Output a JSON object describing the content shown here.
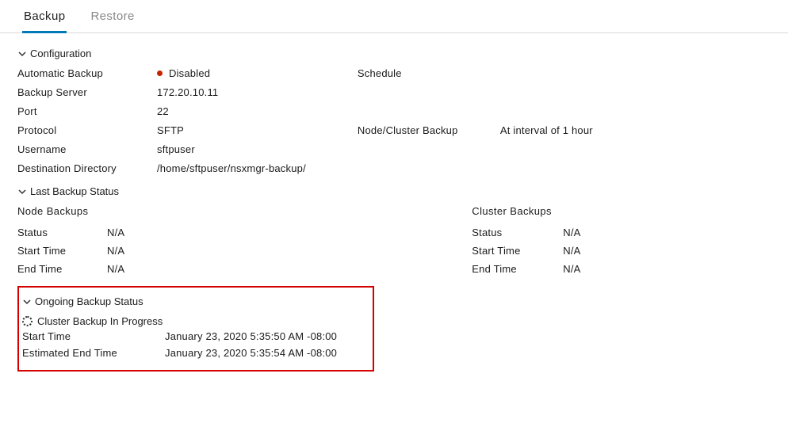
{
  "tabs": {
    "backup": "Backup",
    "restore": "Restore"
  },
  "sections": {
    "configuration": "Configuration",
    "last_backup_status": "Last Backup Status",
    "ongoing_backup_status": "Ongoing Backup Status"
  },
  "config": {
    "automatic_backup_label": "Automatic Backup",
    "automatic_backup_value": "Disabled",
    "backup_server_label": "Backup Server",
    "backup_server_value": "172.20.10.11",
    "port_label": "Port",
    "port_value": "22",
    "protocol_label": "Protocol",
    "protocol_value": "SFTP",
    "username_label": "Username",
    "username_value": "sftpuser",
    "dest_dir_label": "Destination Directory",
    "dest_dir_value": "/home/sftpuser/nsxmgr-backup/",
    "schedule_label": "Schedule",
    "node_cluster_label": "Node/Cluster Backup",
    "node_cluster_value": "At interval of 1 hour"
  },
  "last": {
    "node_heading": "Node Backups",
    "cluster_heading": "Cluster Backups",
    "status_label": "Status",
    "start_time_label": "Start Time",
    "end_time_label": "End Time",
    "node_status": "N/A",
    "node_start": "N/A",
    "node_end": "N/A",
    "cluster_status": "N/A",
    "cluster_start": "N/A",
    "cluster_end": "N/A"
  },
  "ongoing": {
    "progress_text": "Cluster Backup In Progress",
    "start_time_label": "Start Time",
    "start_time_value": "January 23, 2020 5:35:50 AM -08:00",
    "est_end_label": "Estimated End Time",
    "est_end_value": "January 23, 2020 5:35:54 AM -08:00"
  }
}
